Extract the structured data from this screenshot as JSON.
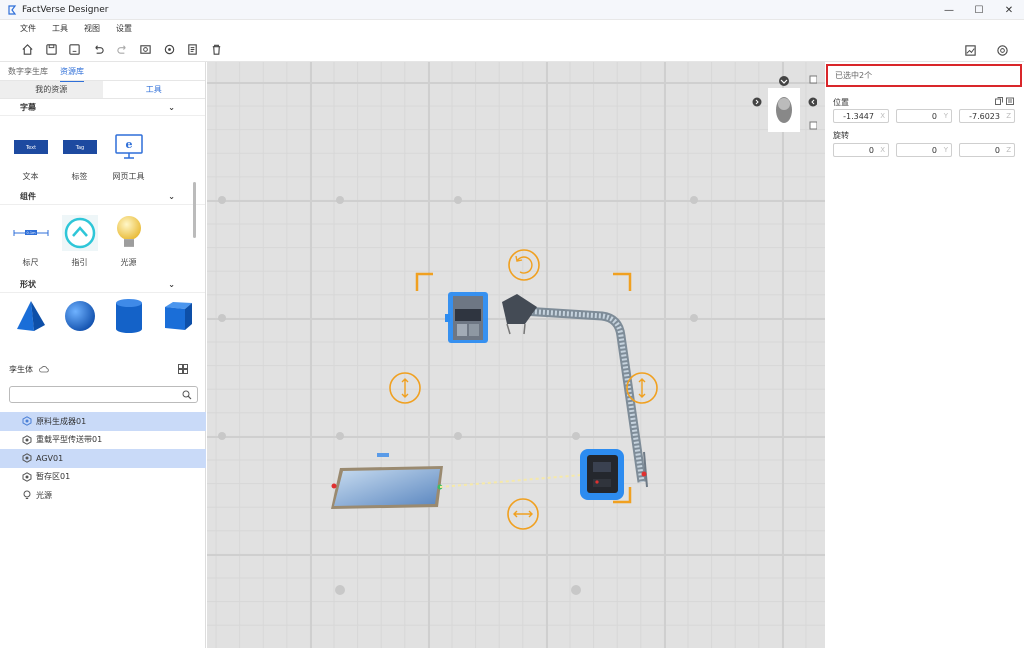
{
  "app": {
    "title": "FactVerse Designer",
    "accent": "#2f6fd8",
    "window_controls": {
      "minimize": "—",
      "maximize": "☐",
      "close": "✕"
    }
  },
  "menu": [
    "文件",
    "工具",
    "视图",
    "设置"
  ],
  "toolbar": {
    "icons": [
      "home-icon",
      "save-icon",
      "save-as-icon",
      "undo-icon",
      "redo-icon",
      "screenshot-icon",
      "settings-icon",
      "document-icon",
      "delete-icon"
    ],
    "right_icons": [
      "chart-icon",
      "camera-icon"
    ]
  },
  "library": {
    "tabs": [
      "数字孪生库",
      "资源库"
    ],
    "active_tab": "资源库",
    "resource_tabs": [
      "我的资源",
      "工具"
    ],
    "sections": [
      {
        "title": "字幕",
        "items": [
          "文本",
          "标签",
          "网页工具"
        ]
      },
      {
        "title": "组件",
        "items": [
          "标尺",
          "指引",
          "光源"
        ]
      },
      {
        "title": "形状",
        "items": [
          "pyramid",
          "sphere",
          "cylinder",
          "cube"
        ]
      }
    ],
    "thumb_text": {
      "text": "Text",
      "tag": "Tag",
      "ruler": "0.1m"
    }
  },
  "twins": {
    "title": "孪生体",
    "search_placeholder": "",
    "items": [
      {
        "name": "原料生成器01",
        "selected": true
      },
      {
        "name": "重载平型传送带01",
        "selected": false
      },
      {
        "name": "AGV01",
        "selected": true
      },
      {
        "name": "暂存区01",
        "selected": false
      },
      {
        "name": "光源",
        "selected": false
      }
    ]
  },
  "properties": {
    "selection_text": "已选中2个",
    "position_label": "位置",
    "rotation_label": "旋转",
    "position": {
      "x": "-1.3447",
      "y": "0",
      "z": "-7.6023"
    },
    "rotation": {
      "x": "0",
      "y": "0",
      "z": "0"
    },
    "axes": [
      "X",
      "Y",
      "Z"
    ]
  },
  "colors": {
    "selection_border": "#d9262a",
    "gizmo": "#f0a020",
    "selected_row": "#c9daf8"
  }
}
